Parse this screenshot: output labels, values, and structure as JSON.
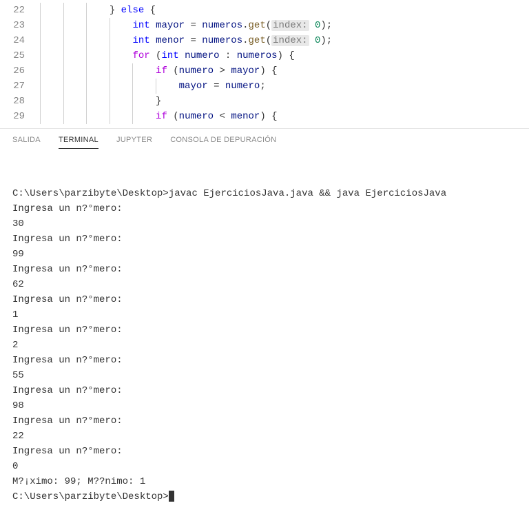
{
  "editor": {
    "lines": [
      {
        "num": "22",
        "indent": 3,
        "tokens": [
          {
            "t": "br",
            "v": "} "
          },
          {
            "t": "else",
            "v": "else"
          },
          {
            "t": "br",
            "v": " {"
          }
        ]
      },
      {
        "num": "23",
        "indent": 4,
        "tokens": [
          {
            "t": "type",
            "v": "int"
          },
          {
            "t": "tx",
            "v": " "
          },
          {
            "t": "var",
            "v": "mayor"
          },
          {
            "t": "tx",
            "v": " = "
          },
          {
            "t": "var",
            "v": "numeros"
          },
          {
            "t": "tx",
            "v": "."
          },
          {
            "t": "meth",
            "v": "get"
          },
          {
            "t": "tx",
            "v": "("
          },
          {
            "t": "hint",
            "v": "index:"
          },
          {
            "t": "tx",
            "v": " "
          },
          {
            "t": "num",
            "v": "0"
          },
          {
            "t": "tx",
            "v": ");"
          }
        ]
      },
      {
        "num": "24",
        "indent": 4,
        "tokens": [
          {
            "t": "type",
            "v": "int"
          },
          {
            "t": "tx",
            "v": " "
          },
          {
            "t": "var",
            "v": "menor"
          },
          {
            "t": "tx",
            "v": " = "
          },
          {
            "t": "var",
            "v": "numeros"
          },
          {
            "t": "tx",
            "v": "."
          },
          {
            "t": "meth",
            "v": "get"
          },
          {
            "t": "tx",
            "v": "("
          },
          {
            "t": "hint",
            "v": "index:"
          },
          {
            "t": "tx",
            "v": " "
          },
          {
            "t": "num",
            "v": "0"
          },
          {
            "t": "tx",
            "v": ");"
          }
        ]
      },
      {
        "num": "25",
        "indent": 4,
        "tokens": [
          {
            "t": "for",
            "v": "for"
          },
          {
            "t": "tx",
            "v": " ("
          },
          {
            "t": "type",
            "v": "int"
          },
          {
            "t": "tx",
            "v": " "
          },
          {
            "t": "var",
            "v": "numero"
          },
          {
            "t": "tx",
            "v": " : "
          },
          {
            "t": "var",
            "v": "numeros"
          },
          {
            "t": "tx",
            "v": ") {"
          }
        ]
      },
      {
        "num": "26",
        "indent": 5,
        "tokens": [
          {
            "t": "if",
            "v": "if"
          },
          {
            "t": "tx",
            "v": " ("
          },
          {
            "t": "var",
            "v": "numero"
          },
          {
            "t": "tx",
            "v": " > "
          },
          {
            "t": "var",
            "v": "mayor"
          },
          {
            "t": "tx",
            "v": ") {"
          }
        ]
      },
      {
        "num": "27",
        "indent": 6,
        "tokens": [
          {
            "t": "var",
            "v": "mayor"
          },
          {
            "t": "tx",
            "v": " = "
          },
          {
            "t": "var",
            "v": "numero"
          },
          {
            "t": "tx",
            "v": ";"
          }
        ]
      },
      {
        "num": "28",
        "indent": 5,
        "tokens": [
          {
            "t": "br",
            "v": "}"
          }
        ]
      },
      {
        "num": "29",
        "indent": 5,
        "tokens": [
          {
            "t": "if",
            "v": "if"
          },
          {
            "t": "tx",
            "v": " ("
          },
          {
            "t": "var",
            "v": "numero"
          },
          {
            "t": "tx",
            "v": " < "
          },
          {
            "t": "var",
            "v": "menor"
          },
          {
            "t": "tx",
            "v": ") {"
          }
        ]
      }
    ]
  },
  "panel": {
    "tabs": [
      {
        "label": "SALIDA",
        "active": false
      },
      {
        "label": "TERMINAL",
        "active": true
      },
      {
        "label": "JUPYTER",
        "active": false
      },
      {
        "label": "CONSOLA DE DEPURACIÓN",
        "active": false
      }
    ]
  },
  "terminal": {
    "lines": [
      "",
      "C:\\Users\\parzibyte\\Desktop>javac EjerciciosJava.java && java EjerciciosJava",
      "Ingresa un n?°mero:",
      "30",
      "Ingresa un n?°mero:",
      "99",
      "Ingresa un n?°mero:",
      "62",
      "Ingresa un n?°mero:",
      "1",
      "Ingresa un n?°mero:",
      "2",
      "Ingresa un n?°mero:",
      "55",
      "Ingresa un n?°mero:",
      "98",
      "Ingresa un n?°mero:",
      "22",
      "Ingresa un n?°mero:",
      "0",
      "M?¡ximo: 99; M??nimo: 1"
    ],
    "prompt": "C:\\Users\\parzibyte\\Desktop>"
  }
}
